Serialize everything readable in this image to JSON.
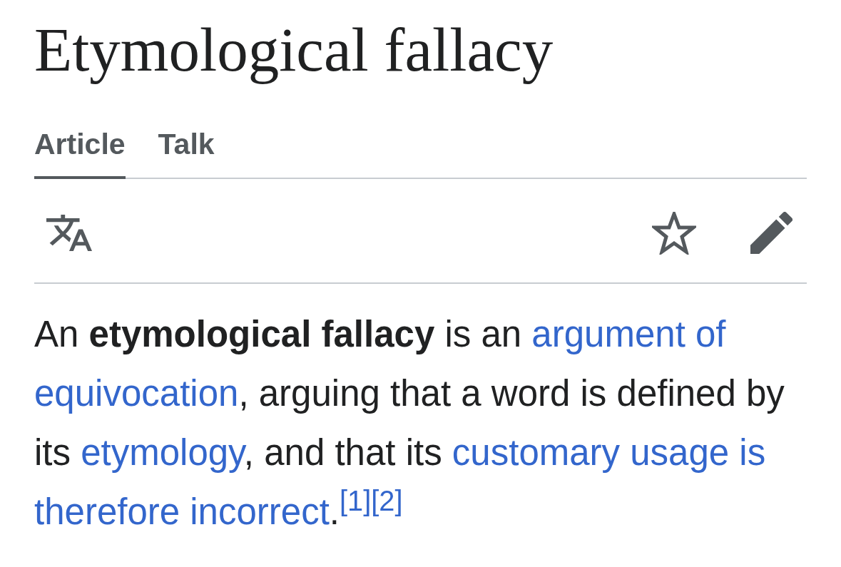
{
  "page": {
    "title": "Etymological fallacy"
  },
  "tabs": [
    {
      "label": "Article",
      "selected": true
    },
    {
      "label": "Talk",
      "selected": false
    }
  ],
  "paragraph": {
    "segments": [
      {
        "kind": "text",
        "text": "An **etymological fallacy** is an "
      },
      {
        "kind": "link",
        "parts": [
          "argument of",
          "equivocation"
        ]
      },
      {
        "kind": "text",
        "text": ", arguing that a word is defined by its "
      },
      {
        "kind": "link",
        "parts": [
          "etymology"
        ]
      },
      {
        "kind": "text",
        "text": ", and that its "
      },
      {
        "kind": "link",
        "parts": [
          "customary usage is",
          "therefore incorrect"
        ]
      },
      {
        "kind": "text",
        "text": "."
      },
      {
        "kind": "citation",
        "text": "[1]"
      },
      {
        "kind": "citation",
        "text": "[2]"
      }
    ]
  }
}
